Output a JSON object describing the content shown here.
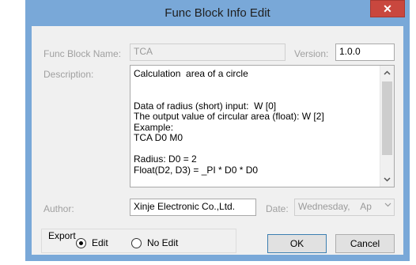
{
  "window": {
    "title": "Func Block Info Edit",
    "close_glyph": "✕"
  },
  "form": {
    "name_label": "Func Block Name:",
    "name_value": "TCA",
    "version_label": "Version:",
    "version_value": "1.0.0",
    "description_label": "Description:",
    "description_text": "Calculation  area of a circle\n\n\nData of radius (short) input:  W [0]\nThe output value of circular area (float): W [2]\nExample:\nTCA D0 M0\n\nRadius: D0 = 2\nFloat(D2, D3) = _PI * D0 * D0",
    "author_label": "Author:",
    "author_value": "Xinje Electronic Co.,Ltd.",
    "date_label": "Date:",
    "date_value": "Wednesday,    Ap"
  },
  "export": {
    "label": "Export",
    "options": [
      {
        "label": "Edit",
        "selected": true
      },
      {
        "label": "No Edit",
        "selected": false
      }
    ]
  },
  "buttons": {
    "ok": "OK",
    "cancel": "Cancel"
  },
  "icons": {
    "scroll_up": "chevron-up-icon",
    "scroll_down": "chevron-down-icon",
    "close": "close-icon",
    "dropdown": "dropdown-arrow-icon"
  }
}
